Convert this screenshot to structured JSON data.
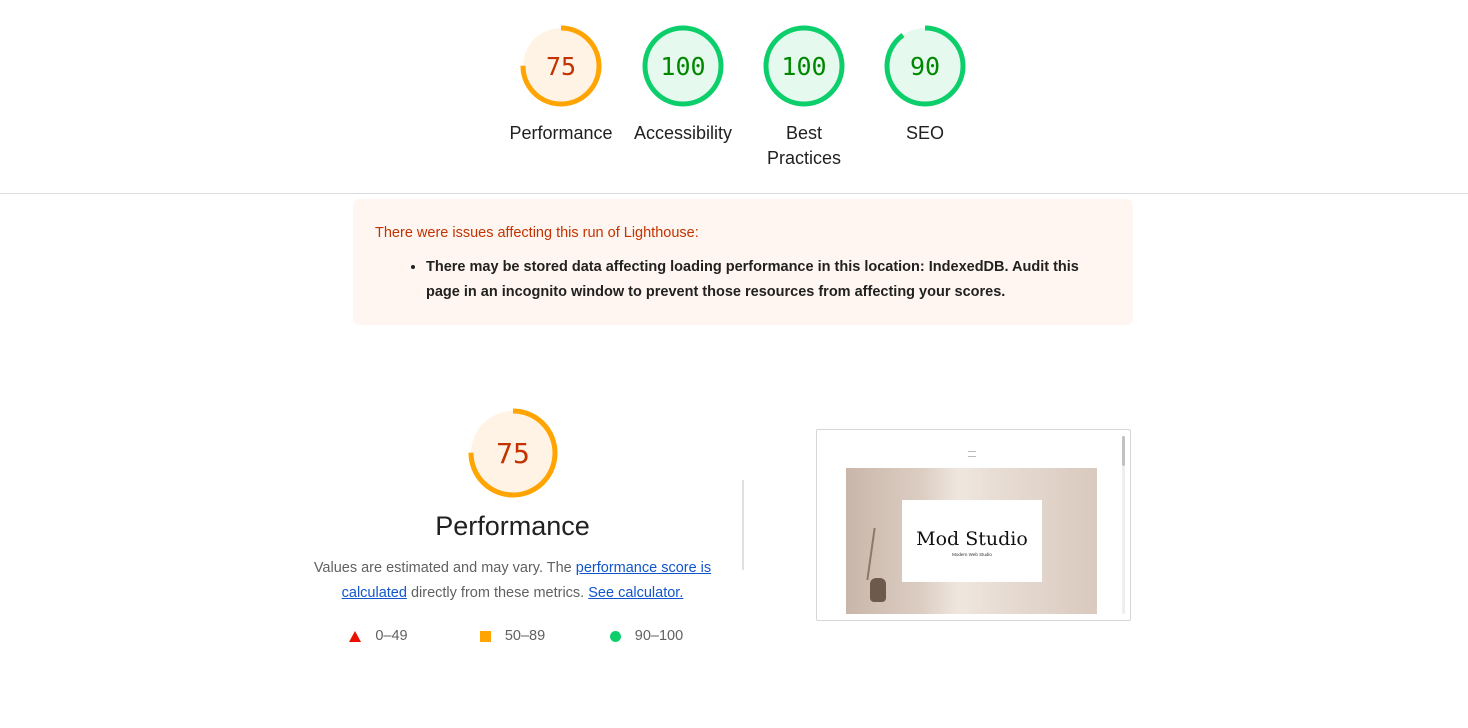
{
  "summary_gauges": [
    {
      "score": "75",
      "label": "Performance",
      "ring_color": "#ffa400",
      "fill_color": "#fff3e6",
      "text_color": "#c33300",
      "fraction": 0.75
    },
    {
      "score": "100",
      "label": "Accessibility",
      "ring_color": "#0cce6b",
      "fill_color": "#e6f9ee",
      "text_color": "#008800",
      "fraction": 1.0
    },
    {
      "score": "100",
      "label_line1": "Best",
      "label_line2": "Practices",
      "ring_color": "#0cce6b",
      "fill_color": "#e6f9ee",
      "text_color": "#008800",
      "fraction": 1.0
    },
    {
      "score": "90",
      "label": "SEO",
      "ring_color": "#0cce6b",
      "fill_color": "#e6f9ee",
      "text_color": "#008800",
      "fraction": 0.9
    }
  ],
  "warning": {
    "title": "There were issues affecting this run of Lighthouse:",
    "items": [
      "There may be stored data affecting loading performance in this location: IndexedDB. Audit this page in an incognito window to prevent those resources from affecting your scores."
    ]
  },
  "performance": {
    "score": "75",
    "fraction": 0.75,
    "title": "Performance",
    "desc_part1": "Values are estimated and may vary. The ",
    "desc_link1": "performance score is calculated",
    "desc_part2": " directly from these metrics. ",
    "desc_link2": "See calculator."
  },
  "legend": {
    "fail": "0–49",
    "average": "50–89",
    "pass": "90–100"
  },
  "screenshot": {
    "site_name": "Mod Studio",
    "site_subtitle": "Modern Web Studio"
  },
  "colors": {
    "fail": "#eb0f00",
    "average": "#ffa400",
    "pass": "#0cce6b"
  }
}
